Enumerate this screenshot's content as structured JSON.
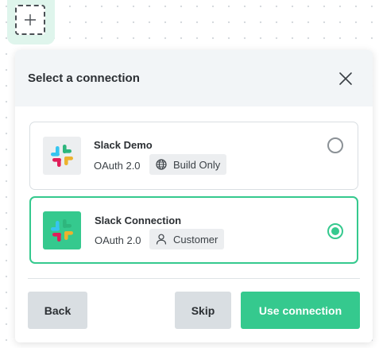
{
  "canvas": {
    "add_node_icon": "plus-icon"
  },
  "dialog": {
    "title": "Select a connection",
    "close_icon": "close-icon"
  },
  "connections": [
    {
      "name": "Slack Demo",
      "auth_type": "OAuth 2.0",
      "tag_label": "Build Only",
      "tag_icon": "globe-icon",
      "selected": false
    },
    {
      "name": "Slack Connection",
      "auth_type": "OAuth 2.0",
      "tag_label": "Customer",
      "tag_icon": "user-icon",
      "selected": true
    }
  ],
  "footer": {
    "back_label": "Back",
    "skip_label": "Skip",
    "use_label": "Use connection"
  },
  "colors": {
    "accent": "#35c98e",
    "header_bg": "#f2f5f7",
    "secondary_button": "#d9dee2"
  }
}
